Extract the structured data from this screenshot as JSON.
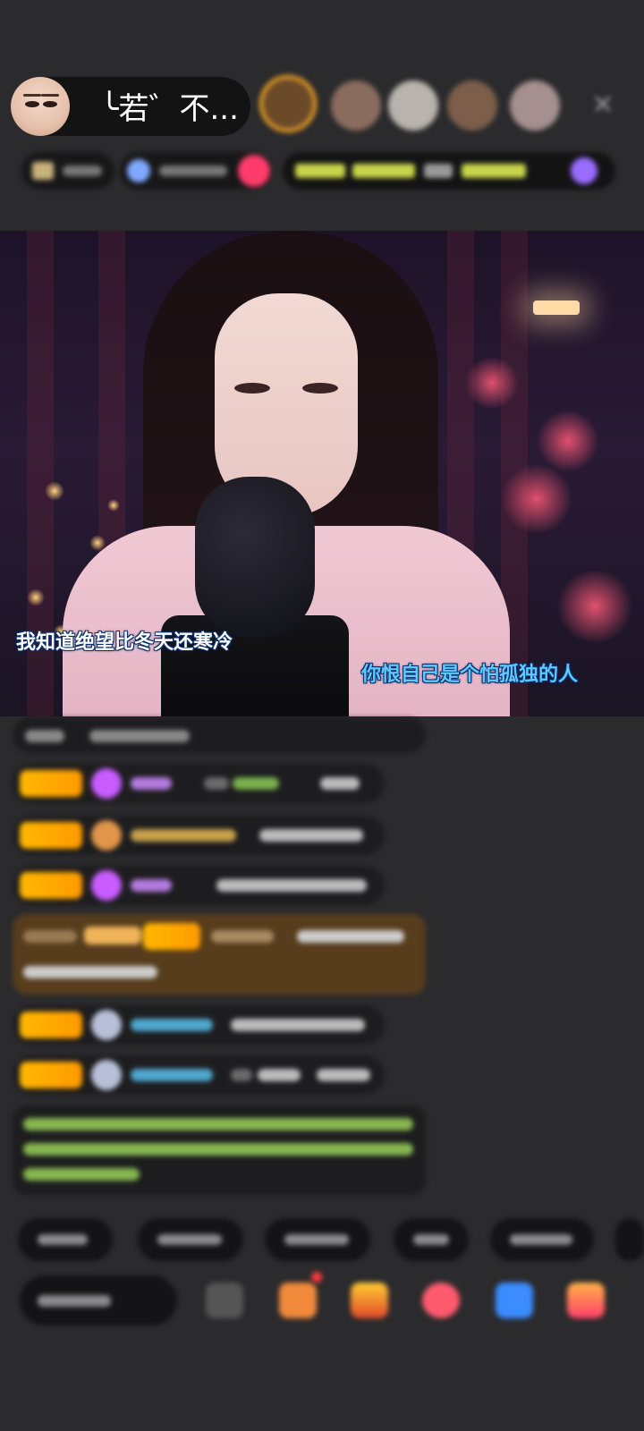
{
  "header": {
    "host_name": "╰若゛不..."
  },
  "video": {
    "lyric_left": "我知道绝望比冬天还寒冷",
    "lyric_right": "你恨自己是个怕孤独的人"
  },
  "colors": {
    "background": "#2b2b2d",
    "badge": "#ffb800",
    "lyric_outline": "#0a2e6a",
    "lyric_right": "#5fc8ff"
  }
}
